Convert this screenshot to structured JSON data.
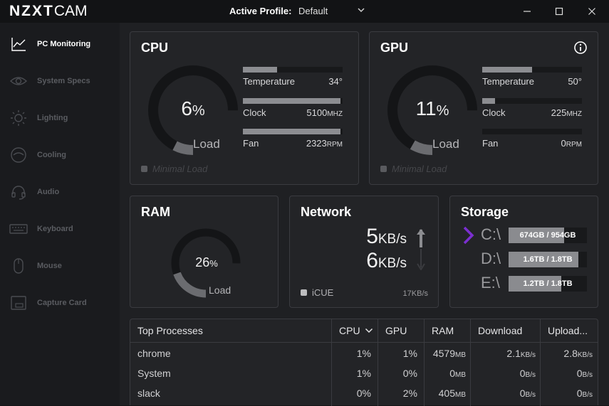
{
  "app": {
    "brand_bold": "NZXT",
    "brand_light": "CAM"
  },
  "titlebar": {
    "profile_label": "Active Profile:",
    "profile_value": "Default"
  },
  "sidebar": {
    "items": [
      {
        "label": "PC Monitoring",
        "icon": "monitoring-chart-icon",
        "active": true
      },
      {
        "label": "System Specs",
        "icon": "eye-icon",
        "active": false
      },
      {
        "label": "Lighting",
        "icon": "sun-icon",
        "active": false
      },
      {
        "label": "Cooling",
        "icon": "cooling-icon",
        "active": false
      },
      {
        "label": "Audio",
        "icon": "headset-icon",
        "active": false
      },
      {
        "label": "Keyboard",
        "icon": "keyboard-icon",
        "active": false
      },
      {
        "label": "Mouse",
        "icon": "mouse-icon",
        "active": false
      },
      {
        "label": "Capture Card",
        "icon": "capture-card-icon",
        "active": false
      }
    ]
  },
  "cpu": {
    "title": "CPU",
    "load_value": "6",
    "load_pct_sign": "%",
    "load_label": "Load",
    "load_fraction": 0.06,
    "stats": [
      {
        "name": "Temperature",
        "value": "34°",
        "unit": "",
        "fraction": 0.34
      },
      {
        "name": "Clock",
        "value": "5100",
        "unit": "MHZ",
        "fraction": 0.98
      },
      {
        "name": "Fan",
        "value": "2323",
        "unit": "RPM",
        "fraction": 0.98
      }
    ],
    "status": "Minimal Load"
  },
  "gpu": {
    "title": "GPU",
    "load_value": "11",
    "load_pct_sign": "%",
    "load_label": "Load",
    "load_fraction": 0.11,
    "stats": [
      {
        "name": "Temperature",
        "value": "50°",
        "unit": "",
        "fraction": 0.5
      },
      {
        "name": "Clock",
        "value": "225",
        "unit": "MHZ",
        "fraction": 0.13
      },
      {
        "name": "Fan",
        "value": "0",
        "unit": "RPM",
        "fraction": 0
      }
    ],
    "status": "Minimal Load"
  },
  "ram": {
    "title": "RAM",
    "value": "26",
    "pct_sign": "%",
    "label": "Load",
    "fraction": 0.26
  },
  "network": {
    "title": "Network",
    "upload_value": "5",
    "download_value": "6",
    "unit": "KB/s",
    "legend": "iCUE",
    "scale_value": "17",
    "scale_unit": "KB/s"
  },
  "storage": {
    "title": "Storage",
    "drives": [
      {
        "letter": "C:\\",
        "usage": "674GB / 954GB",
        "fraction": 0.71,
        "selected": true
      },
      {
        "letter": "D:\\",
        "usage": "1.6TB / 1.8TB",
        "fraction": 0.89,
        "selected": false
      },
      {
        "letter": "E:\\",
        "usage": "1.2TB / 1.8TB",
        "fraction": 0.67,
        "selected": false
      }
    ]
  },
  "processes": {
    "headers": [
      "Top Processes",
      "CPU",
      "GPU",
      "RAM",
      "Download",
      "Upload..."
    ],
    "rows": [
      {
        "name": "chrome",
        "cpu": "1%",
        "gpu": "1%",
        "ram": "4579",
        "ram_unit": "MB",
        "download": "2.1",
        "download_unit": "KB/s",
        "upload": "2.8",
        "upload_unit": "KB/s"
      },
      {
        "name": "System",
        "cpu": "1%",
        "gpu": "0%",
        "ram": "0",
        "ram_unit": "MB",
        "download": "0",
        "download_unit": "B/s",
        "upload": "0",
        "upload_unit": "B/s"
      },
      {
        "name": "slack",
        "cpu": "0%",
        "gpu": "2%",
        "ram": "405",
        "ram_unit": "MB",
        "download": "0",
        "download_unit": "B/s",
        "upload": "0",
        "upload_unit": "B/s"
      }
    ]
  },
  "colors": {
    "accent_purple": "#7b2fd0",
    "gauge_fill": "#6b6c70",
    "gauge_track": "#141517"
  }
}
